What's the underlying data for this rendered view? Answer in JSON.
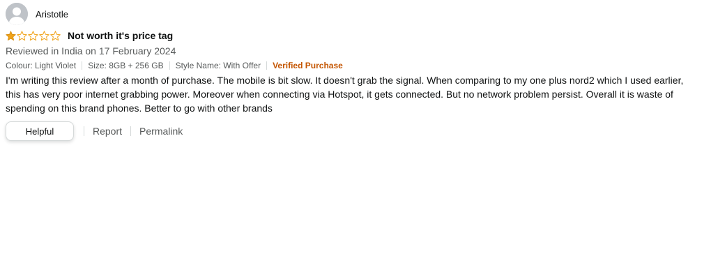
{
  "profile": {
    "name": "Aristotle",
    "avatar_icon": "default-user-avatar-icon"
  },
  "rating": {
    "value": 1,
    "max": 5,
    "filled_color": "#f0a31a",
    "empty_color": "#f0a31a"
  },
  "review": {
    "title": "Not worth it's price tag",
    "date_text": "Reviewed in India on 17 February 2024",
    "colour": "Colour: Light Violet",
    "size": "Size: 8GB + 256 GB",
    "style": "Style Name: With Offer",
    "verified": "Verified Purchase",
    "body": "I'm writing this review after a month of purchase. The mobile is bit slow. It doesn't grab the signal. When comparing to my one plus nord2 which I used earlier, this has very poor internet grabbing power. Moreover when connecting via Hotspot, it gets connected. But no network problem persist. Overall it is waste of spending on this brand phones. Better to go with other brands"
  },
  "actions": {
    "helpful_label": "Helpful",
    "report_label": "Report",
    "permalink_label": "Permalink"
  },
  "colors": {
    "verified_accent": "#c45500",
    "secondary_text": "#565959",
    "primary_text": "#0f1111"
  }
}
